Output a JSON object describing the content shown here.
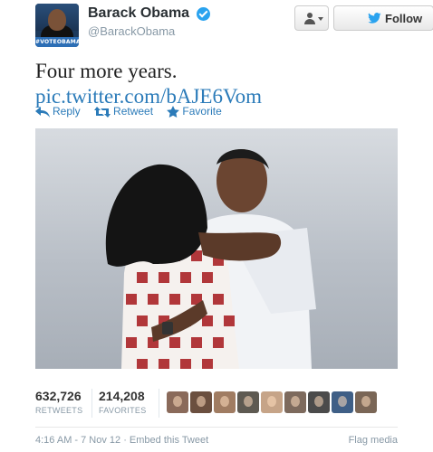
{
  "header": {
    "display_name": "Barack Obama",
    "handle": "@BarackObama",
    "avatar_banner": "#VOTEOBAMA",
    "follow_label": "Follow"
  },
  "tweet": {
    "text": "Four more years.",
    "link": "pic.twitter.com/bAJE6Vom"
  },
  "actions": {
    "reply": "Reply",
    "retweet": "Retweet",
    "favorite": "Favorite"
  },
  "stats": {
    "retweets_value": "632,726",
    "retweets_label": "RETWEETS",
    "favorites_value": "214,208",
    "favorites_label": "FAVORITES"
  },
  "faces": [
    "#8a6a5a",
    "#6b4f3f",
    "#a07c62",
    "#5e5a52",
    "#c6a488",
    "#7d6a5d",
    "#4b4b4b",
    "#3f5f86",
    "#7a6656"
  ],
  "footer": {
    "meta": "4:16 AM - 7 Nov 12 · Embed this Tweet",
    "flag": "Flag media"
  },
  "colors": {
    "link": "#2b7bb9",
    "verified": "#2aa3ef",
    "muted": "#8899a6"
  }
}
